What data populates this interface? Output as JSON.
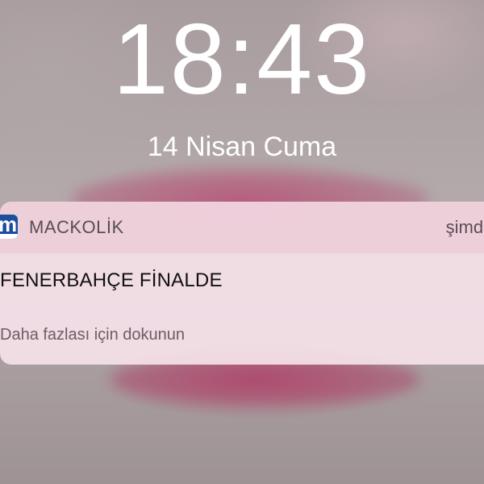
{
  "lockscreen": {
    "time": "18:43",
    "date": "14 Nisan Cuma"
  },
  "notification": {
    "app_icon": "mackolik-app-icon",
    "app_icon_letter": "m",
    "app_name": "MACKOLİK",
    "time": "şimdi",
    "title": "FENERBAHÇE FİNALDE",
    "hint": "Daha fazlası için dokunun"
  },
  "colors": {
    "icon_blue": "#1c4e9c",
    "notification_bg": "#f5e1e8",
    "clock_text": "#ffffff"
  }
}
